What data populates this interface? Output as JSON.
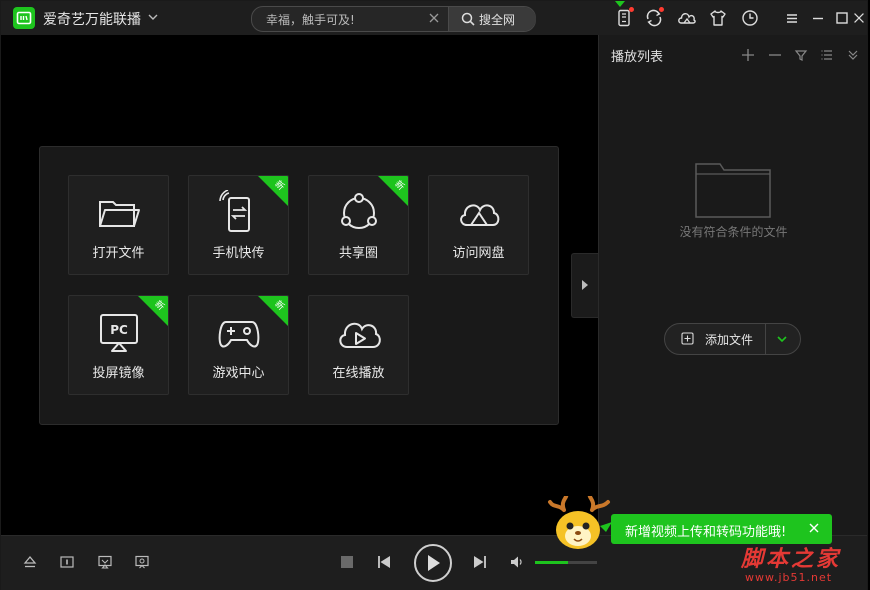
{
  "app": {
    "title": "爱奇艺万能联播"
  },
  "search": {
    "value": "幸福，触手可及!",
    "button_label": "搜全网"
  },
  "tiles": [
    {
      "label": "打开文件",
      "icon": "folder-icon",
      "is_new": false
    },
    {
      "label": "手机快传",
      "icon": "phone-transfer-icon",
      "is_new": true
    },
    {
      "label": "共享圈",
      "icon": "share-circle-icon",
      "is_new": true
    },
    {
      "label": "访问网盘",
      "icon": "cloud-drive-icon",
      "is_new": false
    },
    {
      "label": "投屏镜像",
      "icon": "screen-mirror-icon",
      "is_new": true
    },
    {
      "label": "游戏中心",
      "icon": "gamepad-icon",
      "is_new": true
    },
    {
      "label": "在线播放",
      "icon": "cloud-play-icon",
      "is_new": false
    }
  ],
  "badge_text": "新",
  "mirror_icon_text": "PC",
  "playlist": {
    "title": "播放列表",
    "empty_text": "没有符合条件的文件",
    "add_button_label": "添加文件"
  },
  "player": {
    "volume_level": 0.53
  },
  "toast": {
    "message": "新增视频上传和转码功能哦!"
  },
  "watermark": {
    "main": "脚本之家",
    "sub": "www.jb51.net"
  },
  "colors": {
    "accent": "#1ec41e",
    "background": "#000000",
    "panel": "#191919",
    "alert": "#ff3b30"
  }
}
